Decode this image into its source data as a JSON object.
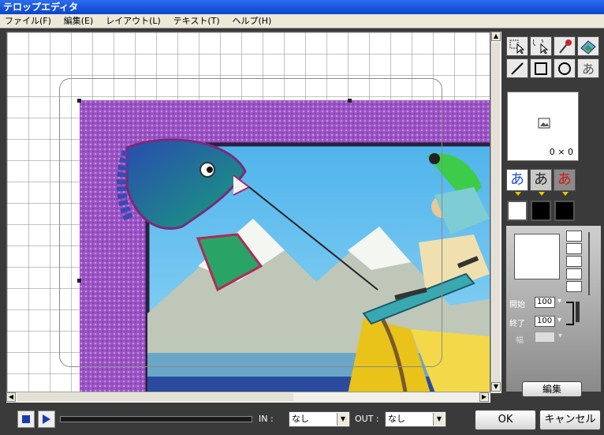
{
  "window": {
    "title": "テロップエディタ"
  },
  "menu": [
    {
      "label": "ファイル(F)"
    },
    {
      "label": "編集(E)"
    },
    {
      "label": "レイアウト(L)"
    },
    {
      "label": "テキスト(T)"
    },
    {
      "label": "ヘルプ(H)"
    }
  ],
  "preview": {
    "size_text": "0 × 0"
  },
  "text_styles": [
    {
      "glyph": "あ",
      "color": "#1a4fd6"
    },
    {
      "glyph": "あ",
      "color": "#222222"
    },
    {
      "glyph": "あ",
      "color": "#d01818"
    }
  ],
  "colors": {
    "swatch1": "#ffffff",
    "swatch2": "#000000",
    "swatch3": "#000000"
  },
  "fields": {
    "start_label": "開始",
    "start_value": "100",
    "end_label": "終了",
    "end_value": "100",
    "width_label": "幅"
  },
  "buttons": {
    "edit": "編集",
    "ok": "OK",
    "cancel": "キャンセル"
  },
  "timeline": {
    "in_label": "IN :",
    "in_value": "なし",
    "out_label": "OUT :",
    "out_value": "なし"
  },
  "icons": {
    "select_tool": "select-arrow-icon",
    "rotate_tool": "rotate-select-icon",
    "eyedropper_tool": "eyedropper-icon",
    "image_tool": "image-insert-icon",
    "line_tool": "line-icon",
    "rect_tool": "rectangle-icon",
    "ellipse_tool": "ellipse-icon",
    "text_tool": "text-icon"
  }
}
